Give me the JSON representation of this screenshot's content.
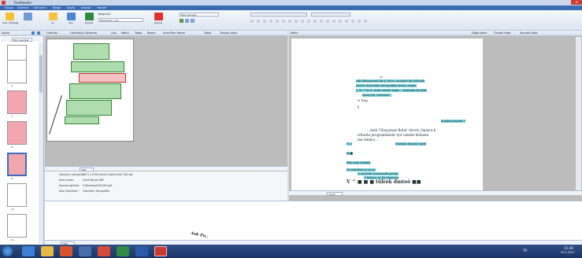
{
  "app": {
    "title": "FineReader",
    "close_label": "✕"
  },
  "menu": [
    "Dosya",
    "Düzenle",
    "Görünüm",
    "Belge",
    "Sayfa",
    "Araçlar",
    "Yardım"
  ],
  "ribbon": {
    "scan_label": "Tara / Belleğe",
    "open_label": "Aç",
    "read_label": "Oku",
    "save_label": "Kaydet",
    "language_label": "Belge dili:",
    "language_value": "Ottomanto, ingi",
    "save_format_value": "Ders Kopyası",
    "pdf_label": "Kaydet"
  },
  "pages_panel": {
    "header": "Sayfa",
    "thumbs": [
      "5",
      "6",
      "7",
      "8",
      "9",
      "10",
      "11",
      "12"
    ],
    "pages_btn_label": "Tüm resimleri"
  },
  "image_pane": {
    "header": "Görüntü",
    "tools": [
      "Görüntüyü Düzenle",
      "Oku",
      "Metni",
      "Tablo",
      "Resim",
      "Arka Plan Resmi",
      "Tablo",
      "Tanıma Alanı"
    ],
    "zoom": "%87"
  },
  "text_pane": {
    "header": "Metin",
    "tools": [
      "Doğrulama",
      "Önceki Hata",
      "Sonraki Hata"
    ],
    "zoom": "%125"
  },
  "page_lines": [
    "Hi",
    "rnb hilmanesini bir § 'öncü, analiyer bir diirenik",
    "tlevlet bezi bilmi liet poslikli, keriş, erişim",
    "§, B. '* M.rl. ürüb entrili 'Ankr... 'Akrimini ke bilir",
    "muaş rin. aramam!..",
    "N  Eng",
    "§",
    "Kunkuyalırpiler 7",
    "...ünlü Tülayyınan Buluf 'devrir, Opuicu-k",
    "ırtlarda programlandır iyır iabede kübasın",
    "ma teklecı...",
    "F:i  t",
    "Dejeyini Kopyalı saydı",
    "tk ■",
    "tllm  tnbn trnlimk",
    "Ifı  tsekvifirn iş  an  jsr",
    "'s ıslı birlü sonrasında  pasaje",
    "'İ Rıdyen ve'  jün bonumu",
    "V ^   ■  ■ ■ tülrek dmtoö ■■"
  ],
  "properties": [
    {
      "label": "Genişlik x yükseklik:",
      "value": "1971 x 2359 piksel   Çözünürlük:   300   dpi"
    },
    {
      "label": "Renk modu:",
      "value": "Siyah Beyaz        RDF"
    },
    {
      "label": "Kaynak görüntü:",
      "value": "F:\\Desktop0002263.pdf"
    },
    {
      "label": "Alan Özellikleri:",
      "value": "Özellikleri  Paragraflar"
    }
  ],
  "notes": {
    "signature": "Ash Fn.."
  },
  "bottom_zoom": "%85",
  "taskbar": {
    "lang": "TR",
    "time": "15:30",
    "date": "29.2.2017"
  },
  "colors": {
    "accent": "#3a6ab0",
    "highlight_green": "#53b453",
    "highlight_red": "#e07878",
    "text_block": "#7cd3df"
  }
}
